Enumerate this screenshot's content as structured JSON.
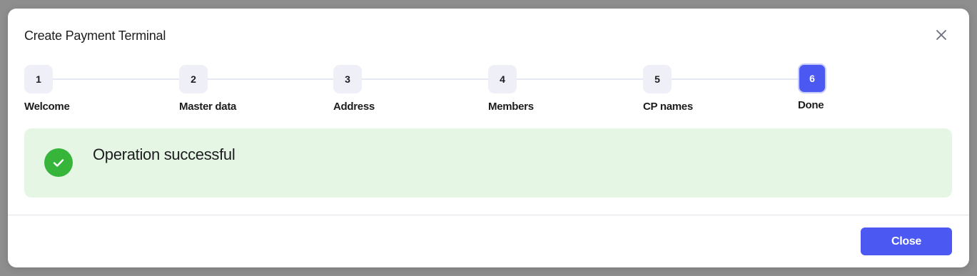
{
  "modal": {
    "title": "Create Payment Terminal",
    "close_icon": "close-icon"
  },
  "stepper": {
    "steps": [
      {
        "number": "1",
        "label": "Welcome",
        "active": false
      },
      {
        "number": "2",
        "label": "Master data",
        "active": false
      },
      {
        "number": "3",
        "label": "Address",
        "active": false
      },
      {
        "number": "4",
        "label": "Members",
        "active": false
      },
      {
        "number": "5",
        "label": "CP names",
        "active": false
      },
      {
        "number": "6",
        "label": "Done",
        "active": true
      }
    ]
  },
  "status": {
    "message": "Operation successful",
    "icon": "check-circle-icon",
    "color": "#36b53a",
    "background": "#e5f6e5"
  },
  "footer": {
    "close_label": "Close"
  },
  "colors": {
    "accent": "#4b58f2",
    "step_inactive": "#eeeff7"
  }
}
